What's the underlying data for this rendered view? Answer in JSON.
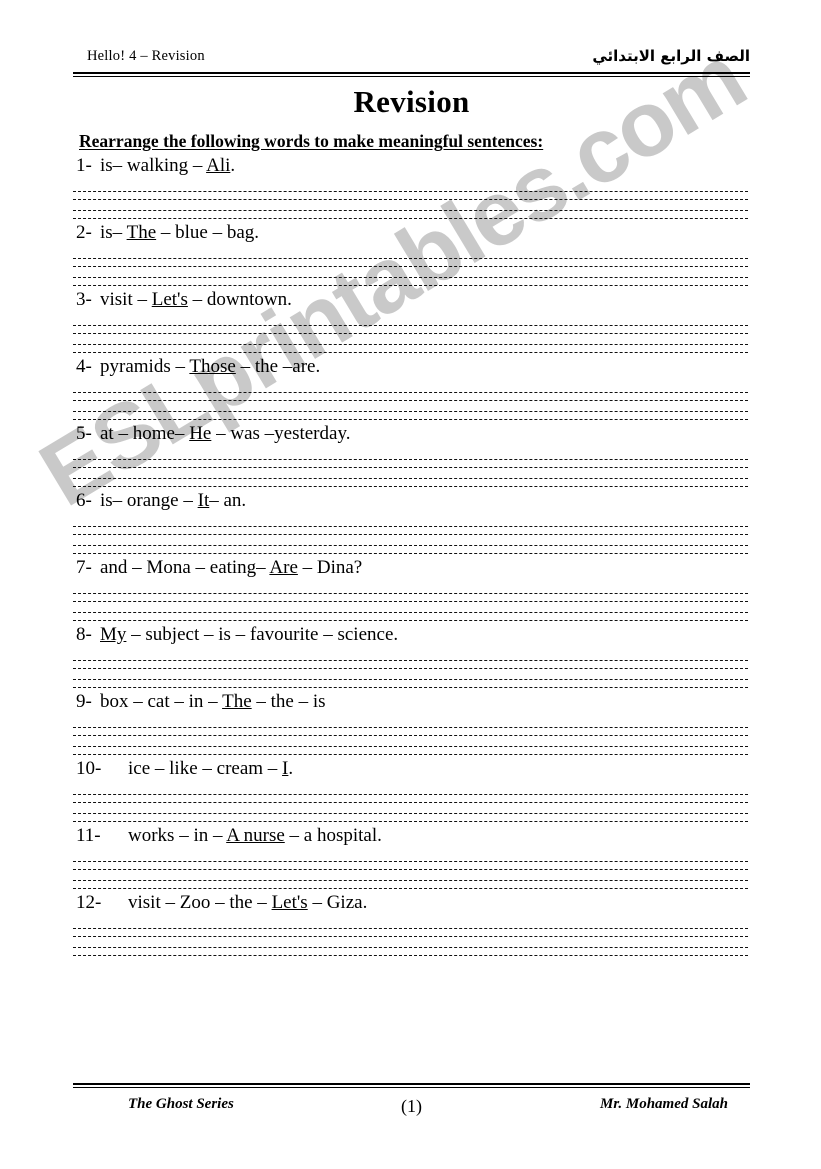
{
  "header": {
    "left_label": "Hello! 4 – Revision",
    "right_label_arabic": "الصف الرابع الابتدائي"
  },
  "title": "Revision",
  "instruction": "Rearrange the following words to make meaningful sentences:",
  "watermark": "ESLprintables.com",
  "watermark_color": "#c9c9c9",
  "exercises": [
    {
      "number": "1-",
      "text": "is– walking – Ali.",
      "underlined": "Ali",
      "wide_indent": false
    },
    {
      "number": "2-",
      "text": "is– The – blue – bag.",
      "underlined": "The",
      "wide_indent": false
    },
    {
      "number": "3-",
      "text": "visit – Let's – downtown.",
      "underlined": "Let's",
      "wide_indent": false
    },
    {
      "number": "4-",
      "text": "pyramids – Those – the –are.",
      "underlined": "Those",
      "wide_indent": false
    },
    {
      "number": "5-",
      "text": "at – home– He – was –yesterday.",
      "underlined": "He",
      "wide_indent": false
    },
    {
      "number": "6-",
      "text": "is– orange – It– an.",
      "underlined": "It",
      "wide_indent": false
    },
    {
      "number": "7-",
      "text": "and – Mona – eating– Are – Dina?",
      "underlined": "Are",
      "wide_indent": false
    },
    {
      "number": "8-",
      "text": "My – subject – is – favourite – science.",
      "underlined": "My",
      "wide_indent": false
    },
    {
      "number": "9-",
      "text": "box – cat – in – The – the – is",
      "underlined": "The",
      "wide_indent": false
    },
    {
      "number": "10-",
      "text": "ice – like – cream – I.",
      "underlined": "I",
      "wide_indent": true
    },
    {
      "number": "11-",
      "text": "works – in – A nurse – a hospital.",
      "underlined": "A nurse",
      "wide_indent": true
    },
    {
      "number": "12-",
      "text": "visit – Zoo – the – Let's – Giza.",
      "underlined": "Let's",
      "wide_indent": true
    }
  ],
  "footer": {
    "series": "The Ghost Series",
    "page_number": "(1)",
    "author": "Mr. Mohamed Salah"
  }
}
